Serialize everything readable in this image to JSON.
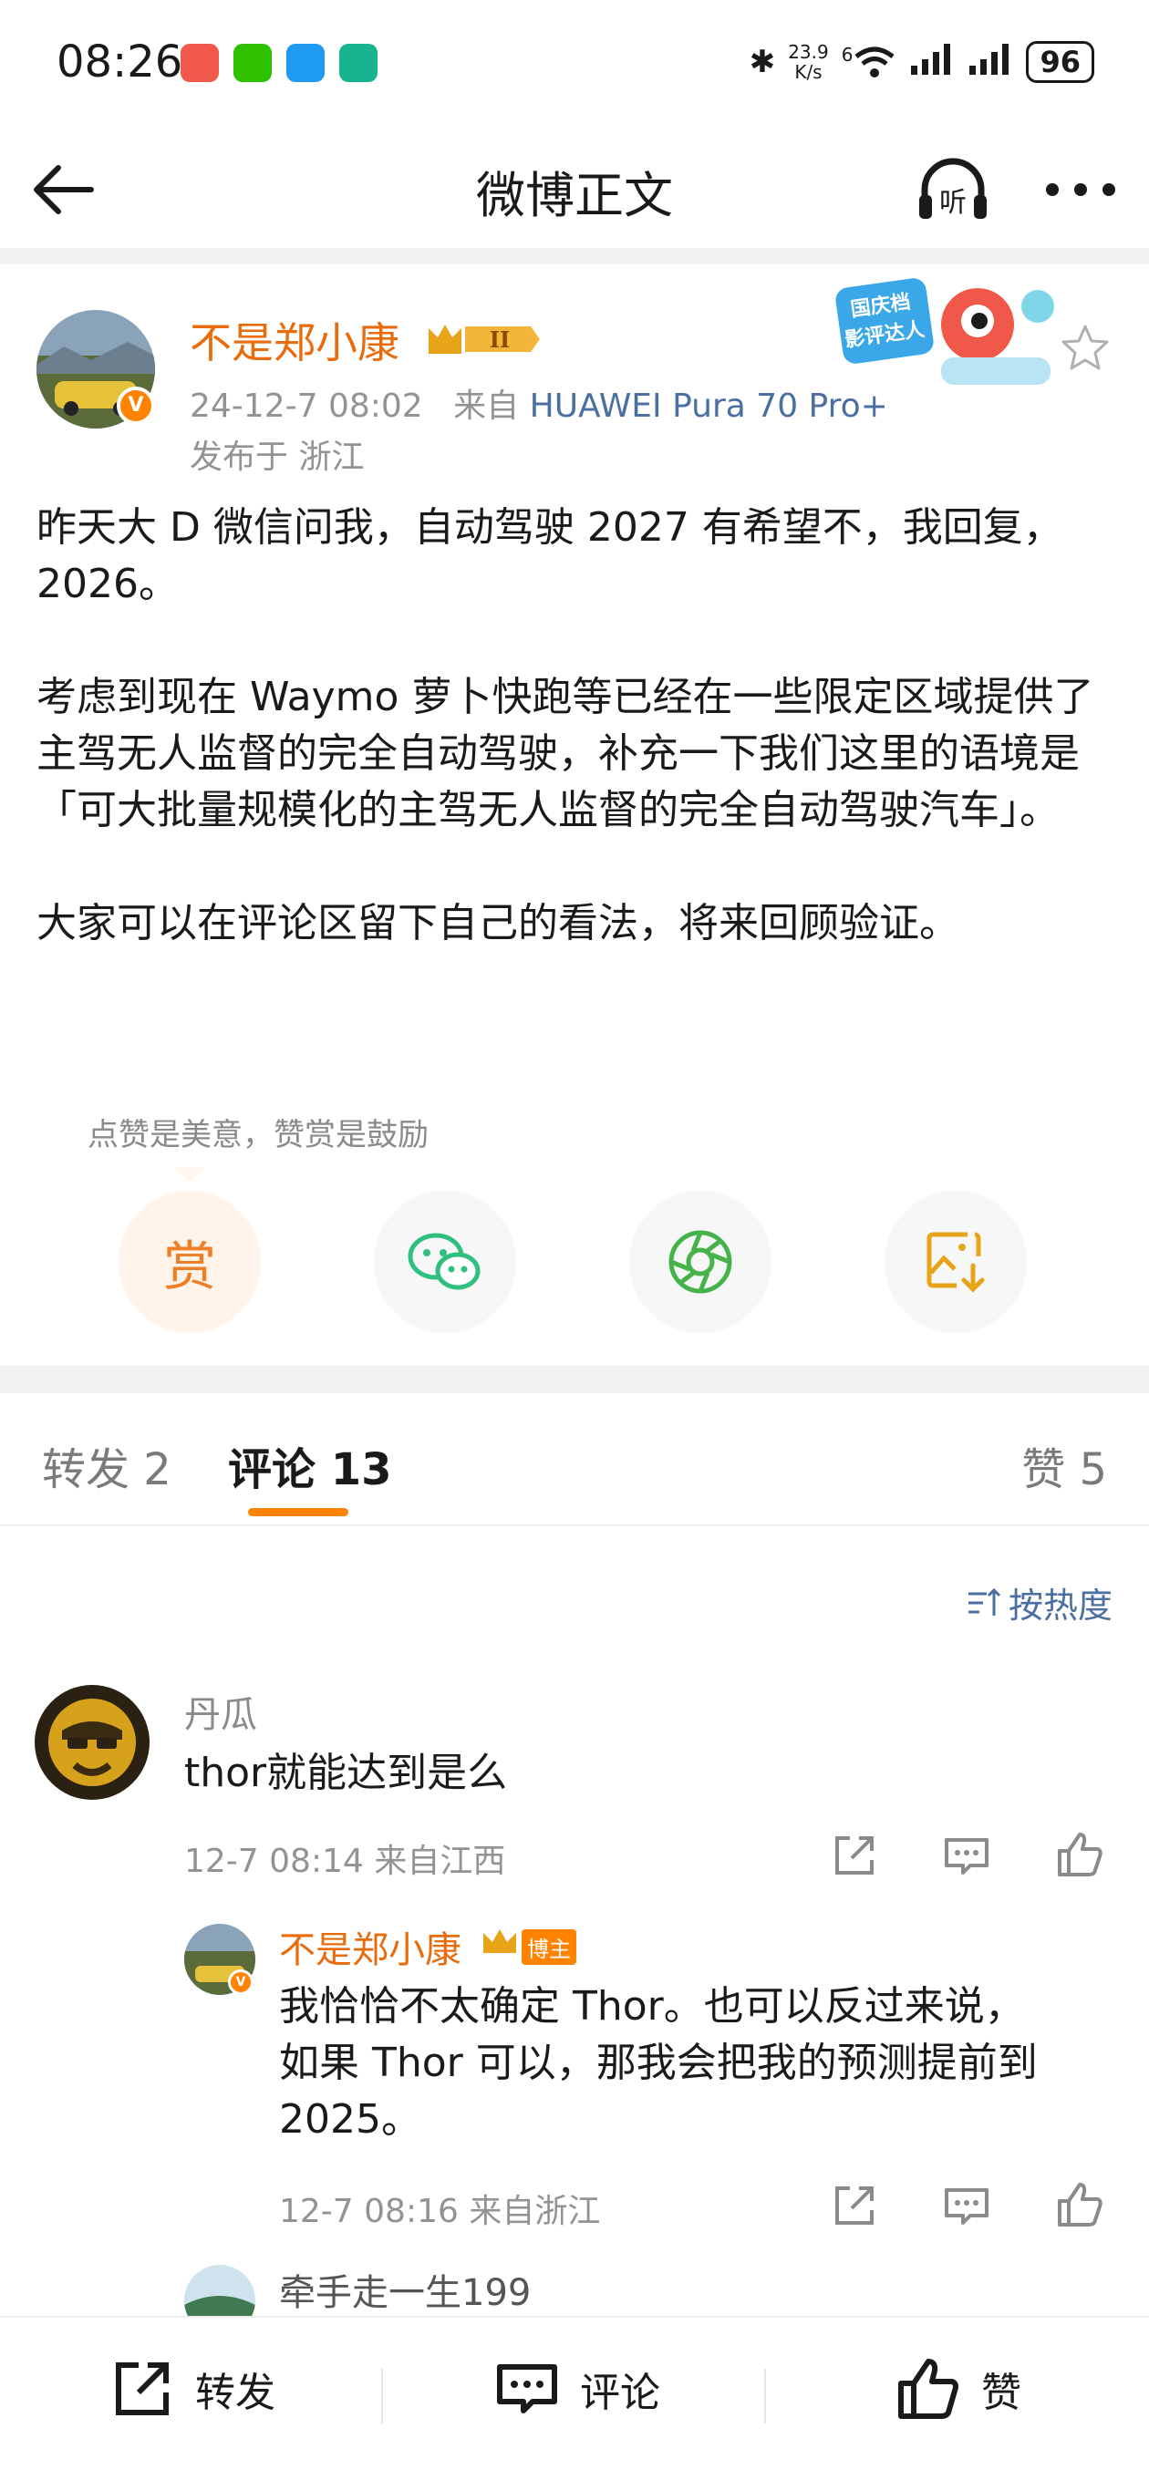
{
  "status_bar": {
    "time": "08:26",
    "net_speed_value": "23.9",
    "net_speed_unit": "K/s",
    "signal_gen": "6",
    "battery": "96"
  },
  "nav": {
    "title": "微博正文",
    "listen_label": "听"
  },
  "post": {
    "author": "不是郑小康",
    "level": "II",
    "date": "24-12-7 08:02",
    "source_prefix": "来自",
    "device": "HUAWEI Pura 70 Pro+",
    "location": "发布于 浙江",
    "event_badge_text": "国庆档影评达人",
    "paragraphs": [
      "昨天大 D 微信问我，自动驾驶 2027 有希望不，我回复，2026。",
      "考虑到现在 Waymo 萝卜快跑等已经在一些限定区域提供了主驾无人监督的完全自动驾驶，补充一下我们这里的语境是「可大批量规模化的主驾无人监督的完全自动驾驶汽车」。",
      "大家可以在评论区留下自己的看法，将来回顾验证。"
    ],
    "reward_hint": "点赞是美意，赞赏是鼓励",
    "reward_label": "赏"
  },
  "tabs": {
    "repost": "转发 2",
    "comment": "评论 13",
    "like": "赞 5"
  },
  "sort_label": "按热度",
  "comments": [
    {
      "name": "丹瓜",
      "text": "thor就能达到是么",
      "meta": "12-7 08:14 来自江西"
    }
  ],
  "reply": {
    "name": "不是郑小康",
    "badge": "博主",
    "lines": [
      "我恰恰不太确定 Thor。也可以反过来说，",
      "如果 Thor 可以，那我会把我的预测提前到",
      "2025。"
    ],
    "meta": "12-7 08:16 来自浙江"
  },
  "next_comment_name": "牵手走一生199",
  "bottom_bar": {
    "repost": "转发",
    "comment": "评论",
    "like": "赞"
  },
  "colors": {
    "accent": "#ff8200",
    "author": "#e86b0c",
    "link": "#4a6fa0"
  }
}
